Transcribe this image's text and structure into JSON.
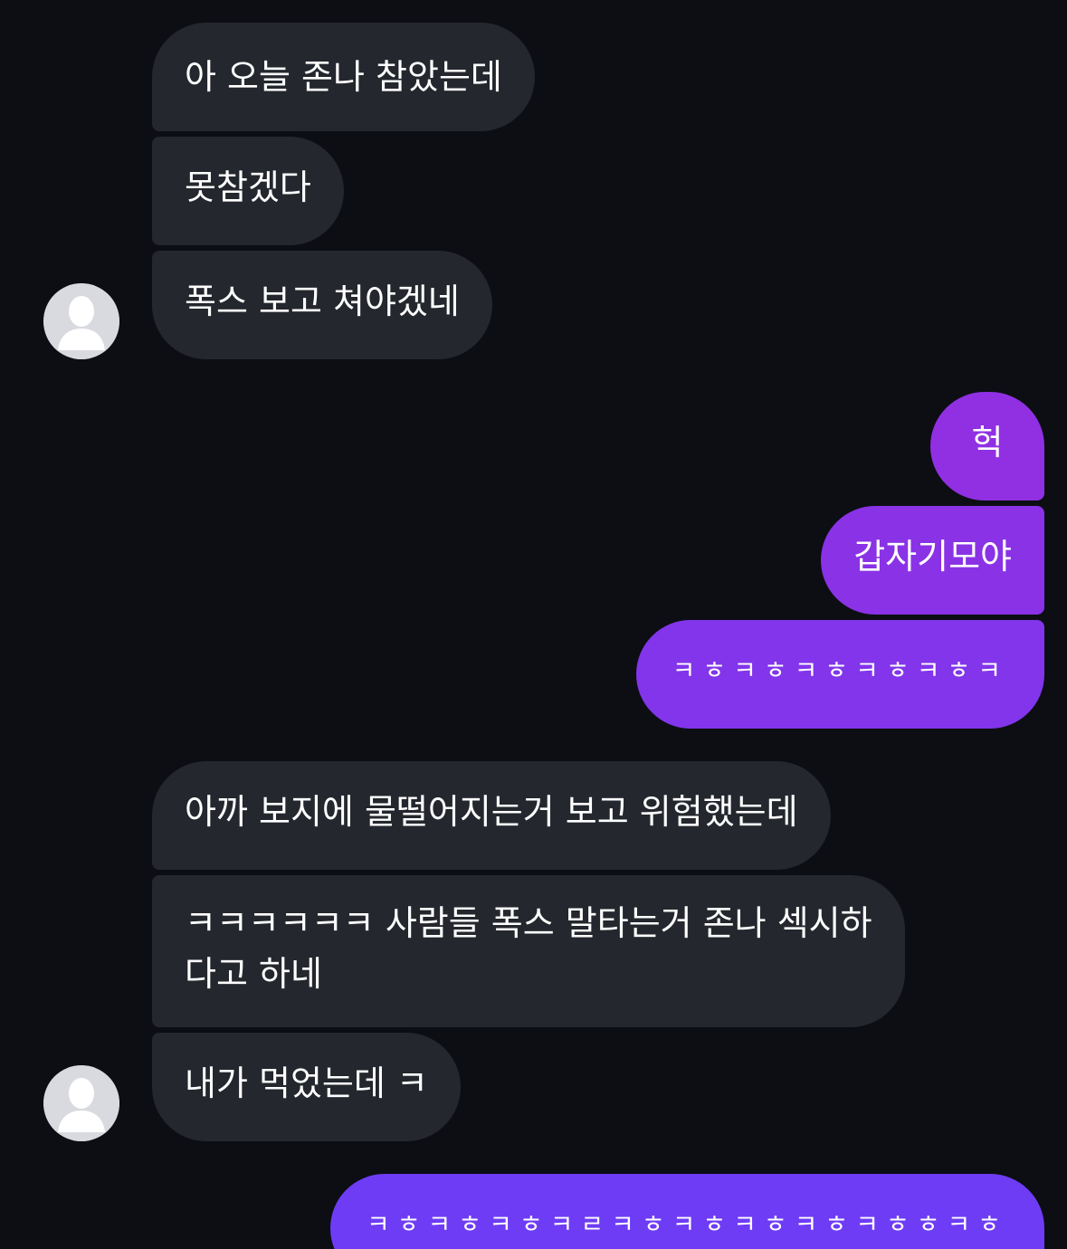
{
  "incoming_group_1": [
    "아 오늘 존나 참았는데",
    "못참겠다",
    "폭스 보고 쳐야겠네"
  ],
  "outgoing_group_1": [
    "헉",
    "갑자기모야",
    "ㅋㅎㅋㅎㅋㅎㅋㅎㅋㅎㅋ"
  ],
  "incoming_group_2": [
    "아까 보지에 물떨어지는거 보고 위험했는데",
    "ㅋㅋㅋㅋㅋㅋ 사람들 폭스 말타는거 존나 섹시하",
    "다고 하네",
    "내가 먹었는데 ㅋ"
  ],
  "outgoing_group_2": [
    "ㅋㅎㅋㅎㅋㅎㅋㄹㅋㅎㅋㅎㅋㅎㅋㅎㅋㅎㅎㅋㅎ"
  ],
  "colors": {
    "background": "#0c0e13",
    "incoming_bubble": "#24272d",
    "outgoing_gradient_top": "#9030e2",
    "outgoing_gradient_bottom": "#6e3cf5",
    "text": "#ffffff"
  },
  "icons": {
    "avatar": "default-user-avatar-icon"
  }
}
